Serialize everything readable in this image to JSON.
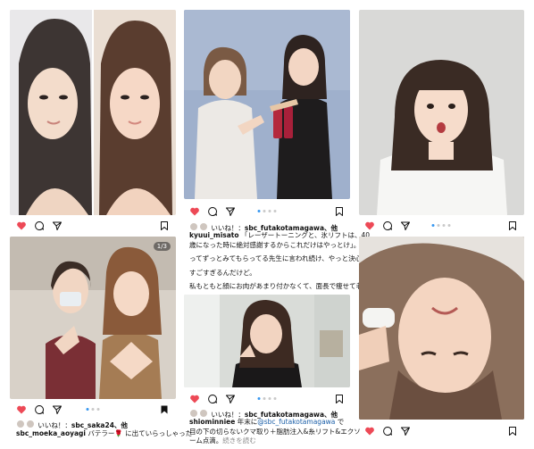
{
  "colors": {
    "like": "#ed4956",
    "carousel_active": "#3797f0",
    "carousel_inactive": "#c9c9c9",
    "link": "#1b5fa8"
  },
  "icons": [
    "heart-icon",
    "comment-icon",
    "share-icon",
    "bookmark-icon"
  ],
  "posts": [
    {
      "id": "p1",
      "liked": true,
      "carousel": null
    },
    {
      "id": "p2",
      "liked": true,
      "carousel": {
        "count": 4,
        "active": 0
      },
      "likes_prefix": "いいね！：",
      "likes_user": "sbc_futakotamagawa、他",
      "caption_user": "kyuui_misato",
      "caption_lines": [
        "「レーザートーニングと、氷リフトは、40",
        "歳になった時に絶対感謝するからこれだけはやっとけ」。"
      ],
      "caption_para2": "ってずっとみてもらってる先生に言われ続け、やっと決心。",
      "caption_para3": "すごすぎるんだけど。",
      "caption_para4": "私もともと顔にお肉があまり付かなくて、面長で痩せて老け"
    },
    {
      "id": "p3",
      "liked": true,
      "carousel": {
        "count": 4,
        "active": 0
      }
    },
    {
      "id": "p4",
      "liked": true,
      "badge": "1/3",
      "carousel": {
        "count": 3,
        "active": 0
      },
      "likes_prefix": "いいね！：",
      "likes_user": "sbc_saka24、他",
      "caption_user": "sbc_moeka_aoyagi",
      "caption_text": "バテラー🌹 に出ていらっしゃった"
    },
    {
      "id": "p5",
      "liked": true,
      "carousel": {
        "count": 4,
        "active": 0
      },
      "likes_prefix": "いいね！：",
      "likes_user": "sbc_futakotamagawa、他",
      "caption_user": "shiominniee",
      "caption_text_a": "年末に",
      "caption_tag": "@sbc_futakotamagawa",
      "caption_text_b": "で",
      "caption_line2": "目の下の切らないクマ取り＋脂肪注入&糸リフト&エクソ",
      "caption_line3": "ーム点滴。",
      "caption_more": "続きを読む"
    },
    {
      "id": "p6",
      "liked": true,
      "carousel": null
    }
  ]
}
